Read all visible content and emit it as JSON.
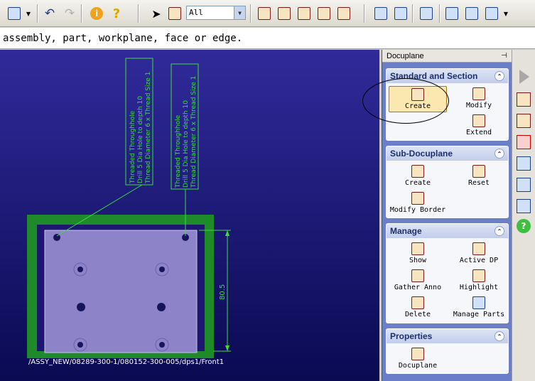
{
  "toolbar": {
    "filter_value": "All"
  },
  "prompt": {
    "text": "assembly, part, workplane, face or edge."
  },
  "viewport": {
    "callout_1": [
      "Threaded Throughhole",
      "Drill 5 Dia Hole to depth 10",
      "Thread Diameter 6 x Thread Size 1"
    ],
    "callout_2": [
      "Threaded Throughhole",
      "Drill 5 Dia Hole to depth 10",
      "Thread Diameter 6 x Thread Size 1"
    ],
    "dimension": "80.5",
    "path": "/ASSY_NEW/08289-300-1/080152-300-005/dps1/Front1"
  },
  "panel": {
    "title": "Docuplane",
    "groups": [
      {
        "title": "Standard and Section",
        "items": [
          "Create",
          "Modify",
          "Extend"
        ]
      },
      {
        "title": "Sub-Docuplane",
        "items": [
          "Create",
          "Reset",
          "Modify Border"
        ]
      },
      {
        "title": "Manage",
        "items": [
          "Show",
          "Active DP",
          "Gather Anno",
          "Highlight",
          "Delete",
          "Manage Parts"
        ]
      },
      {
        "title": "Properties",
        "items": [
          "Docuplane"
        ]
      }
    ]
  },
  "icons": {
    "info": "i",
    "help": "?",
    "help_strip": "?"
  },
  "colors": {
    "viewport_top": "#302a9a",
    "viewport_bottom": "#0a0a52",
    "frame_green": "#1e8a2a",
    "plate": "#8d83c8",
    "callout": "#3cdc3c"
  }
}
